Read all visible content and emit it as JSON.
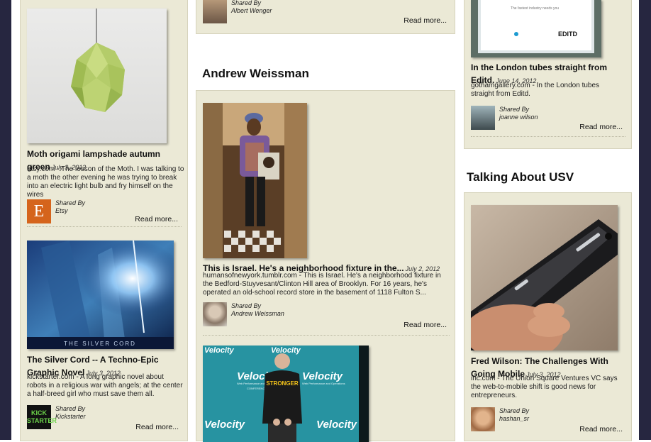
{
  "left_column": {
    "posts": [
      {
        "title": "Moth origami lampshade autumn green",
        "date": "July 3, 2012",
        "description": "etsy.com - The lesson of the Moth. I was talking to a moth the other evening he was trying to break into an electric light bulb and fry himself on the wires",
        "shared_by_label": "Shared By",
        "shared_by": "Etsy",
        "avatar_letter": "E",
        "read_more": "Read more..."
      },
      {
        "title": "The Silver Cord -- A Techno-Epic Graphic Novel",
        "date": "July 3, 2012",
        "description": "kickstarter.com - A long graphic novel about robots in a religious war with angels; at the center a half-breed girl who must save them all.",
        "shared_by_label": "Shared By",
        "shared_by": "Kickstarter",
        "avatar_text": "KICK STARTER",
        "image_caption": "THE SILVER CORD",
        "read_more": "Read more..."
      }
    ]
  },
  "middle_column": {
    "top_card": {
      "shared_by_label": "Shared By",
      "shared_by": "Albert Wenger",
      "read_more": "Read more..."
    },
    "section_title": "Andrew Weissman",
    "posts": [
      {
        "title": "This is Israel. He's a neighborhood fixture in the...",
        "date": "July 2, 2012",
        "description": "humansofnewyork.tumblr.com - This is Israel. He's a neighborhood fixture in the Bedford-Stuyvesant/Clinton Hill area of Brooklyn. For 16 years, he's operated an old-school record store in the basement of 1118 Fulton S...",
        "shared_by_label": "Shared By",
        "shared_by": "Andrew Weissman",
        "read_more": "Read more..."
      }
    ],
    "velocity_image": {
      "brand": "Velocity",
      "tagline": "Web Performance and Operations",
      "conference": "CONFERENCE",
      "shirt_text": "STRONGER"
    }
  },
  "right_column": {
    "top_post": {
      "image_brand": "EDITD",
      "image_text": "The fastest industry needs you",
      "title": "In the London tubes straight from Editd.",
      "date": "June 14, 2012",
      "description": "gothamgallery.com - In the London tubes straight from Editd.",
      "shared_by_label": "Shared By",
      "shared_by": "joanne wilson",
      "read_more": "Read more..."
    },
    "section_title": "Talking About USV",
    "posts": [
      {
        "title": "Fred Wilson: The Challenges With Going Mobile",
        "date": "July 3, 2012",
        "description": "inc.com - The Union Square Ventures VC says the web-to-mobile shift is good news for entrepreneurs.",
        "shared_by_label": "Shared By",
        "shared_by": "hashan_sr",
        "read_more": "Read more..."
      }
    ]
  },
  "colors": {
    "card_bg": "#ebe9d6",
    "page_bg": "#ffffff",
    "side_bar": "#262640",
    "etsy_orange": "#d5641c"
  }
}
